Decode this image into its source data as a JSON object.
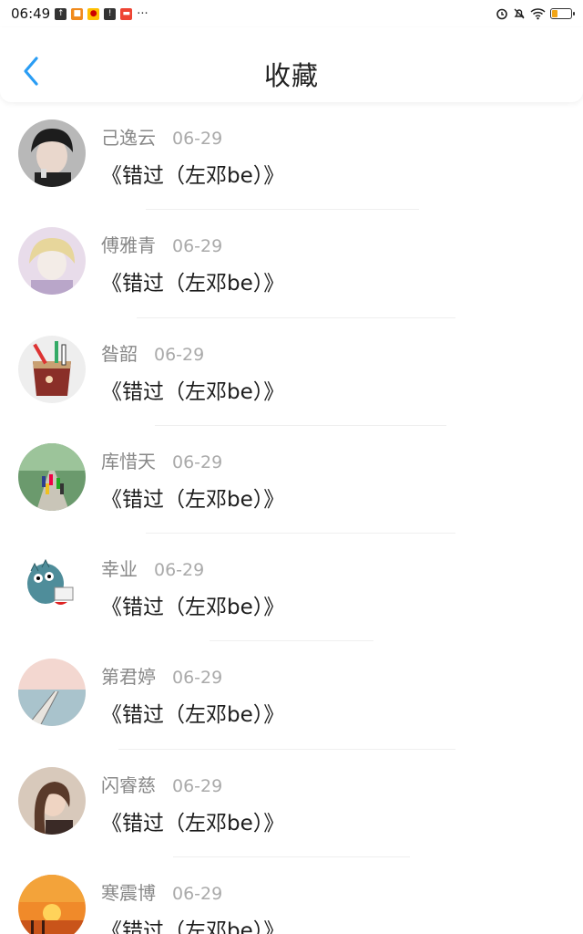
{
  "status_bar": {
    "time": "06:49",
    "more": "···"
  },
  "header": {
    "title": "收藏"
  },
  "colors": {
    "accent": "#2a9df4",
    "battery": "#f2a516"
  },
  "items": [
    {
      "user": "己逸云",
      "date": "06-29",
      "title": "《错过（左邓be）》",
      "avatar_icon": "avatar-dark-hair"
    },
    {
      "user": "傅雅青",
      "date": "06-29",
      "title": "《错过（左邓be）》",
      "avatar_icon": "avatar-anime-blonde"
    },
    {
      "user": "昝韶",
      "date": "06-29",
      "title": "《错过（左邓be）》",
      "avatar_icon": "avatar-pencil-cup"
    },
    {
      "user": "库惜天",
      "date": "06-29",
      "title": "《错过（左邓be）》",
      "avatar_icon": "avatar-runners-road"
    },
    {
      "user": "幸业",
      "date": "06-29",
      "title": "《错过（左邓be）》",
      "avatar_icon": "avatar-cartoon-dino"
    },
    {
      "user": "第君婷",
      "date": "06-29",
      "title": "《错过（左邓be）》",
      "avatar_icon": "avatar-pier-sea"
    },
    {
      "user": "闪睿慈",
      "date": "06-29",
      "title": "《错过（左邓be）》",
      "avatar_icon": "avatar-girl-portrait"
    },
    {
      "user": "寒震博",
      "date": "06-29",
      "title": "《错过（左邓be）》",
      "avatar_icon": "avatar-sunset"
    }
  ]
}
